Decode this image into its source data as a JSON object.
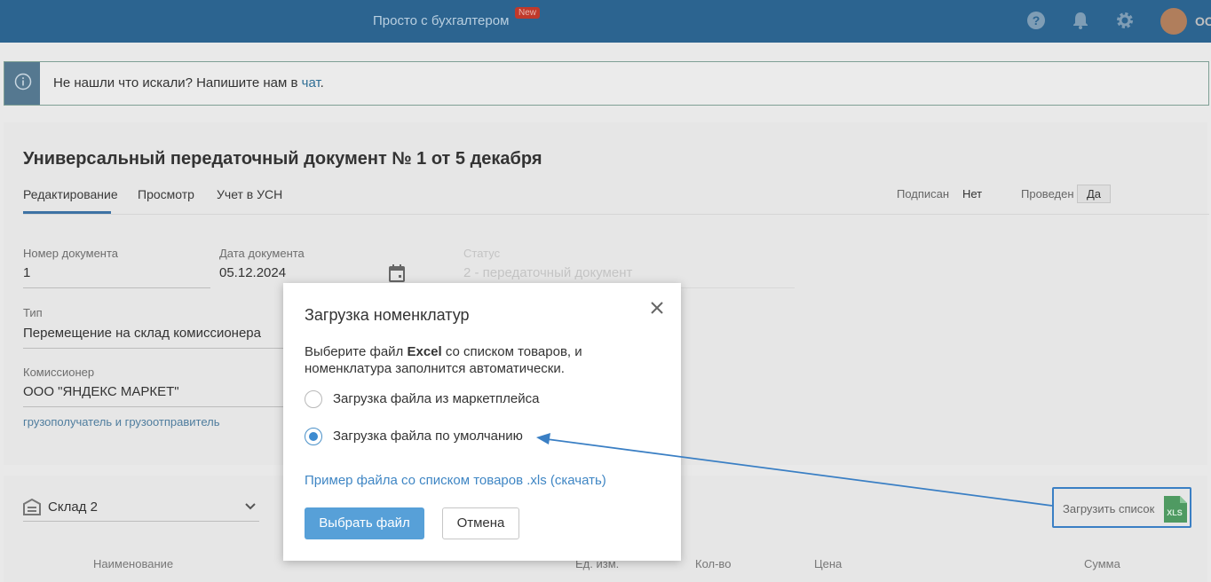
{
  "topbar": {
    "promo": "Просто с бухгалтером",
    "new_badge": "New",
    "user_initials": "OC",
    "icons": [
      "help-icon",
      "bell-icon",
      "gear-icon"
    ]
  },
  "info": {
    "text": "Не нашли что искали? Напишите нам в ",
    "link": "чат",
    "tail": "."
  },
  "document": {
    "title": "Универсальный передаточный документ № 1 от 5 декабря",
    "tabs": [
      "Редактирование",
      "Просмотр",
      "Учет в УСН"
    ],
    "signed_label": "Подписан",
    "signed_value": "Нет",
    "posted_label": "Проведен",
    "posted_value": "Да",
    "fields": {
      "number_label": "Номер документа",
      "number_value": "1",
      "date_label": "Дата документа",
      "date_value": "05.12.2024",
      "status_label": "Статус",
      "status_value": "2 - передаточный документ",
      "type_label": "Тип",
      "type_value": "Перемещение на склад комиссионера",
      "commissioner_label": "Комиссионер",
      "commissioner_value": "ООО \"ЯНДЕКС МАРКЕТ\"",
      "consignee_link": "грузополучатель и грузоотправитель"
    }
  },
  "warehouse": {
    "value": "Склад 2",
    "upload_label": "Загрузить список",
    "xls_label": "XLS"
  },
  "table": {
    "columns": [
      "Наименование",
      "Ед. изм.",
      "Кол-во",
      "Цена",
      "Сумма"
    ]
  },
  "modal": {
    "title": "Загрузка номенклатур",
    "desc_prefix": "Выберите файл ",
    "desc_bold": "Excel",
    "desc_suffix": " со списком товаров, и номенклатура заполнится автоматически.",
    "options": [
      {
        "label": "Загрузка файла из маркетплейса",
        "checked": false
      },
      {
        "label": "Загрузка файла по умолчанию",
        "checked": true
      }
    ],
    "sample_link": "Пример файла со списком товаров .xls (скачать)",
    "choose_button": "Выбрать файл",
    "cancel_button": "Отмена"
  },
  "colors": {
    "topbar": "#2c6490",
    "accent": "#3d8bd0",
    "primary_button": "#57a0d8",
    "annotation": "#3a7fc4"
  }
}
